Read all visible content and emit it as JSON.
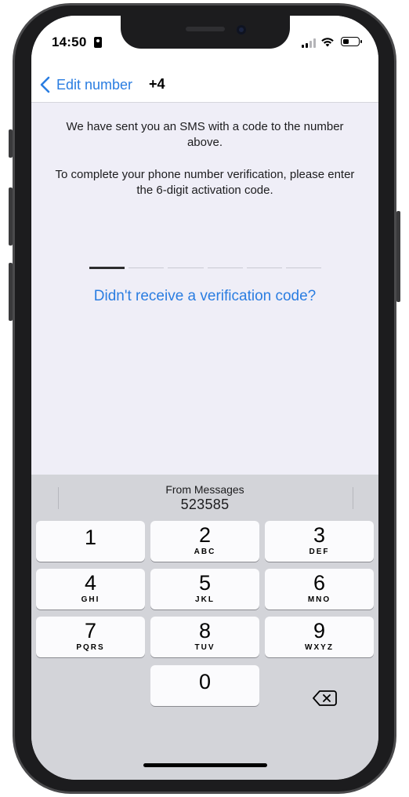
{
  "status_bar": {
    "time": "14:50",
    "icons": [
      "sim-card-icon",
      "signal-icon",
      "wifi-icon",
      "battery-icon"
    ]
  },
  "nav": {
    "back_label": "Edit number",
    "number_prefix": "+4"
  },
  "content": {
    "sms_notice": "We have sent you an SMS with a code to the number above.",
    "instruction": "To complete your phone number verification, please enter the 6-digit activation code.",
    "code_slots": 6,
    "resend_link": "Didn't receive a verification code?"
  },
  "keyboard": {
    "suggestion_label": "From Messages",
    "suggestion_code": "523585",
    "keys": [
      {
        "digit": "1",
        "letters": ""
      },
      {
        "digit": "2",
        "letters": "ABC"
      },
      {
        "digit": "3",
        "letters": "DEF"
      },
      {
        "digit": "4",
        "letters": "GHI"
      },
      {
        "digit": "5",
        "letters": "JKL"
      },
      {
        "digit": "6",
        "letters": "MNO"
      },
      {
        "digit": "7",
        "letters": "PQRS"
      },
      {
        "digit": "8",
        "letters": "TUV"
      },
      {
        "digit": "9",
        "letters": "WXYZ"
      },
      {
        "digit": "0",
        "letters": ""
      }
    ]
  },
  "colors": {
    "accent": "#2a7de1",
    "background": "#efeef7",
    "keyboard": "#d3d4d9",
    "key": "#fbfbfd"
  }
}
